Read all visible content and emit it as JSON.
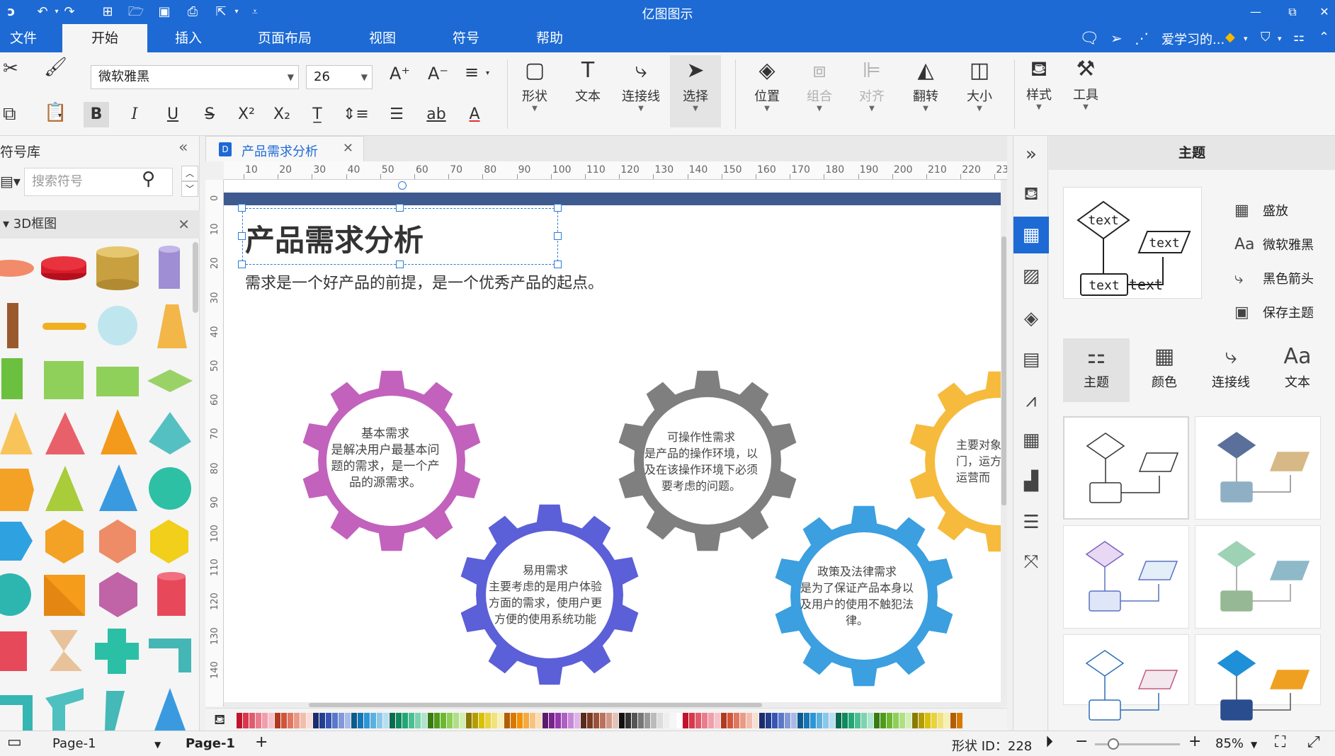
{
  "app": {
    "title": "亿图图示"
  },
  "menu": {
    "tabs": [
      "文件",
      "开始",
      "插入",
      "页面布局",
      "视图",
      "符号",
      "帮助"
    ],
    "user": "爱学习的..."
  },
  "ribbon": {
    "font_name": "微软雅黑",
    "font_size": "26",
    "buttons": {
      "shape": "形状",
      "text": "文本",
      "connector": "连接线",
      "select": "选择",
      "position": "位置",
      "group": "组合",
      "align": "对齐",
      "flip": "翻转",
      "size": "大小",
      "style": "样式",
      "tools": "工具"
    }
  },
  "library": {
    "title": "符号库",
    "search_placeholder": "搜索符号",
    "category": "3D框图"
  },
  "document": {
    "tab": "产品需求分析",
    "title": "产品需求分析",
    "subtitle": "需求是一个好产品的前提，是一个优秀产品的起点。",
    "gears": [
      {
        "title": "基本需求",
        "body": "是解决用户最基本问题的需求，是一个产品的源需求。",
        "color": "#c262bd"
      },
      {
        "title": "可操作性需求",
        "body": "是产品的操作环境，以及在该操作环境下必须要考虑的问题。",
        "color": "#7f7f7f"
      },
      {
        "title": "易用需求",
        "body": "主要考虑的是用户体验方面的需求，使用户更方便的使用系统功能",
        "color": "#5b5fd8"
      },
      {
        "title": "政策及法律需求",
        "body": "是为了保证产品本身以及用户的使用不触犯法律。",
        "color": "#3b9fe0"
      },
      {
        "title": "运",
        "body": "主要对象部门，运方便运营而",
        "color": "#f6bb3c"
      }
    ]
  },
  "ruler": {
    "h": [
      "10",
      "20",
      "30",
      "40",
      "50",
      "60",
      "70",
      "80",
      "90",
      "100",
      "110",
      "120",
      "130",
      "140",
      "150",
      "160",
      "170",
      "180",
      "190",
      "200",
      "210",
      "220",
      "23"
    ],
    "v": [
      "0",
      "10",
      "20",
      "30",
      "40",
      "50",
      "60",
      "70",
      "80",
      "90",
      "100",
      "110",
      "120",
      "130",
      "140"
    ]
  },
  "right_panel": {
    "title": "主题",
    "preview_labels": [
      "text",
      "text",
      "text",
      "text"
    ],
    "options": [
      {
        "icon": "palette-icon",
        "label": "盛放"
      },
      {
        "icon": "font-icon",
        "label": "微软雅黑"
      },
      {
        "icon": "connector-icon",
        "label": "黑色箭头"
      },
      {
        "icon": "save-icon",
        "label": "保存主题"
      }
    ],
    "tabs": [
      "主题",
      "颜色",
      "连接线",
      "文本"
    ]
  },
  "status": {
    "page_selector": "Page-1",
    "page_tab": "Page-1",
    "shape_id": "形状 ID：228",
    "zoom": "85%"
  },
  "colors": {
    "accent": "#1d6ad4"
  }
}
